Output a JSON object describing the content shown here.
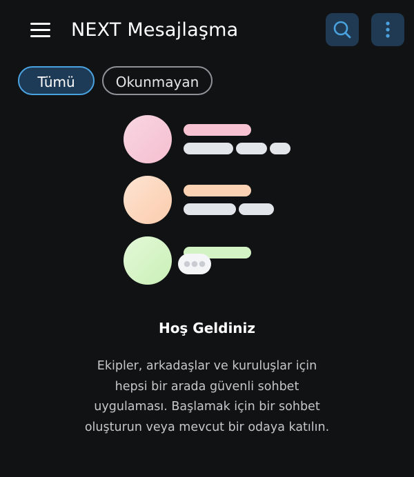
{
  "header": {
    "title": "NEXT Mesajlaşma",
    "menu_icon": "hamburger-menu-icon",
    "search_icon": "search-icon",
    "more_icon": "more-vertical-icon"
  },
  "filters": {
    "all": "Tümü",
    "unread": "Okunmayan",
    "active": "all"
  },
  "welcome": {
    "title": "Hoş Geldiniz",
    "message": "Ekipler, arkadaşlar ve kuruluşlar için hepsi bir arada güvenli sohbet uygulaması. Başlamak için bir sohbet oluşturun veya mevcut bir odaya katılın."
  },
  "colors": {
    "background": "#111214",
    "accent": "#4aa3e0",
    "icon_button_bg": "#1f3a52",
    "avatar_pink": "#f7c9d6",
    "avatar_peach": "#fcd7bd",
    "avatar_green": "#d6f5c6"
  }
}
